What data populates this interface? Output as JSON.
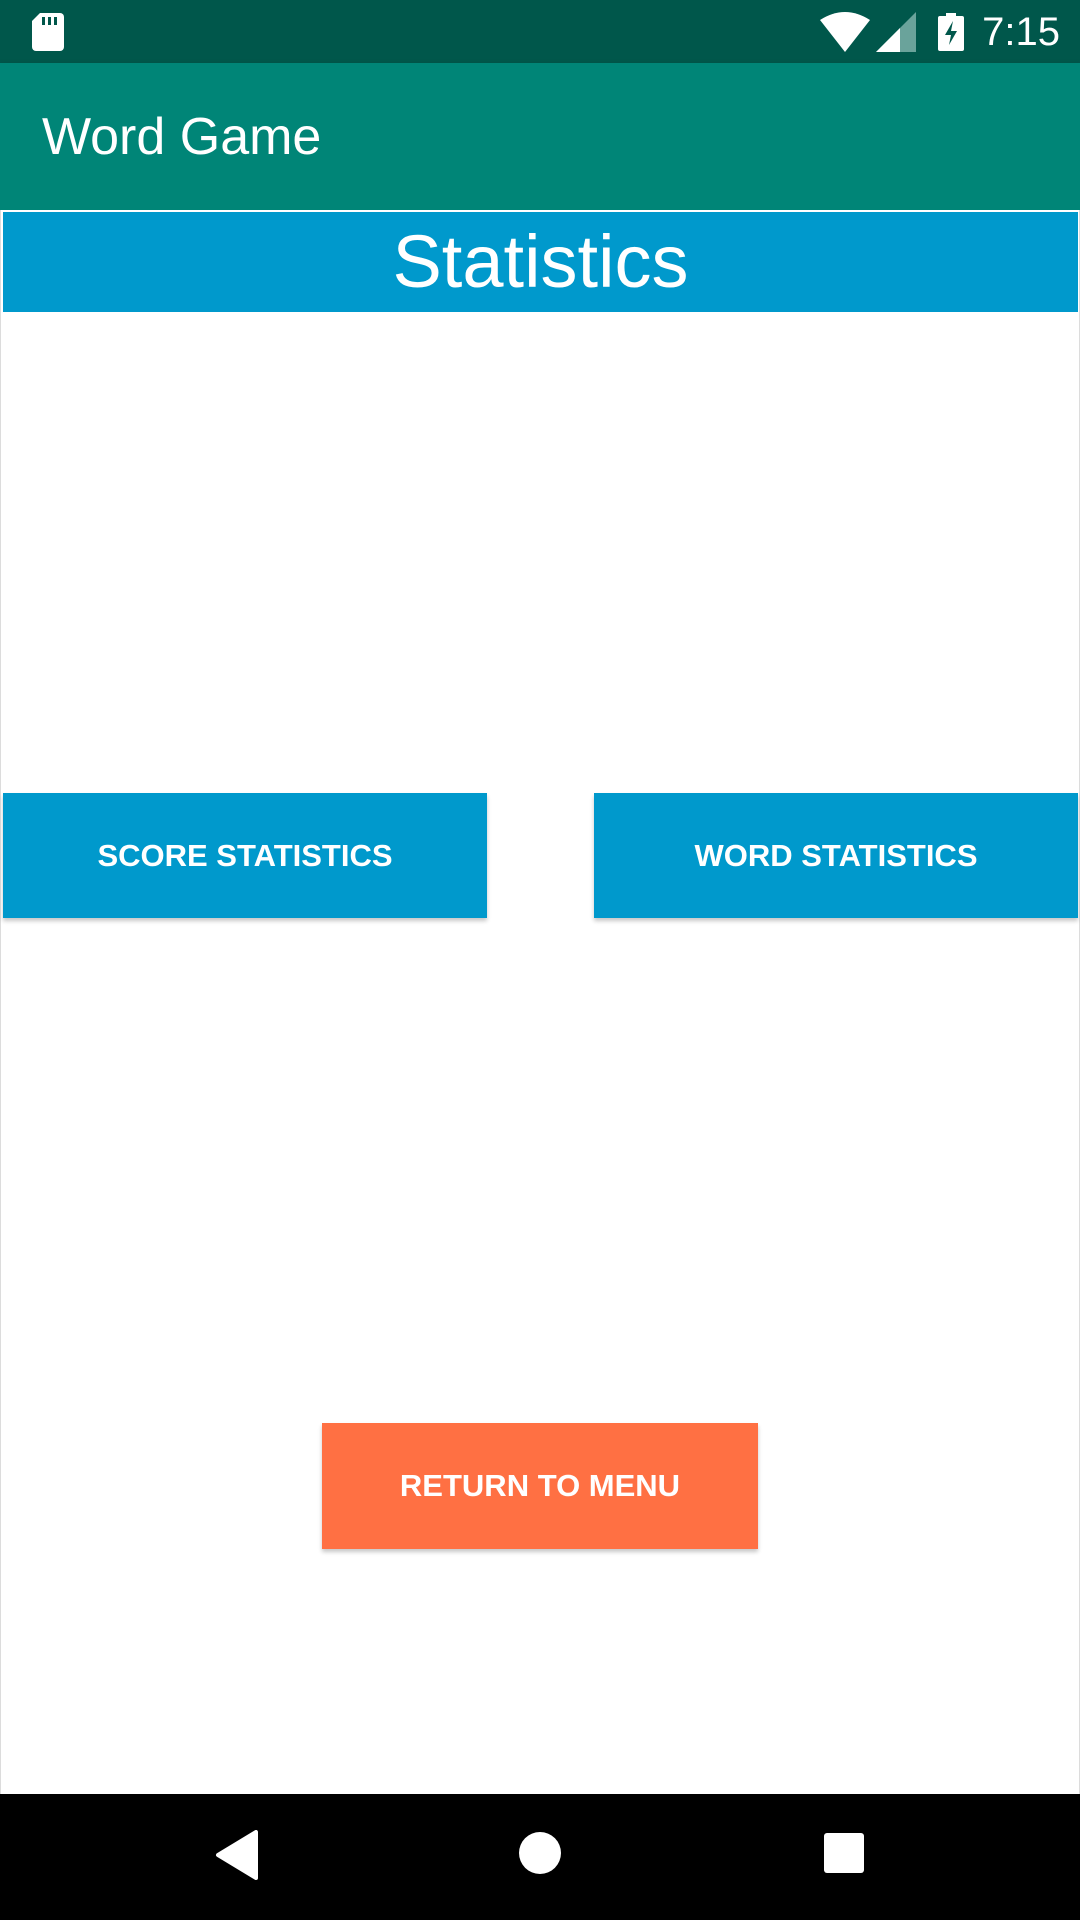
{
  "status_bar": {
    "time": "7:15",
    "icons": [
      "sd-card-icon",
      "wifi-icon",
      "cell-signal-icon",
      "battery-charging-icon"
    ]
  },
  "app_bar": {
    "title": "Word Game",
    "color": "#008577"
  },
  "screen": {
    "title": "Statistics",
    "title_color": "#0099cc"
  },
  "buttons": {
    "score_statistics": "SCORE STATISTICS",
    "word_statistics": "WORD STATISTICS",
    "return_to_menu": "RETURN TO MENU"
  },
  "colors": {
    "status_bar": "#00574b",
    "accent_blue": "#0099cc",
    "accent_orange": "#ff7043"
  },
  "nav_bar": {
    "icons": [
      "back-icon",
      "home-icon",
      "recents-icon"
    ]
  }
}
